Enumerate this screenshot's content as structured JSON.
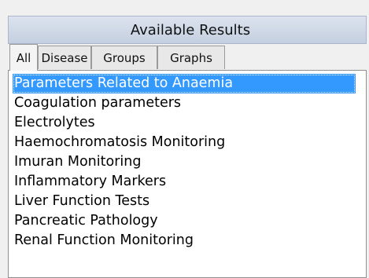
{
  "panel": {
    "title": "Available Results"
  },
  "tabs": [
    {
      "label": "All",
      "selected": true
    },
    {
      "label": "Disease",
      "selected": false
    },
    {
      "label": "Groups",
      "selected": false
    },
    {
      "label": "Graphs",
      "selected": false
    }
  ],
  "results": {
    "items": [
      {
        "label": "Parameters Related to Anaemia",
        "selected": true
      },
      {
        "label": "Coagulation parameters",
        "selected": false
      },
      {
        "label": "Electrolytes",
        "selected": false
      },
      {
        "label": "Haemochromatosis Monitoring",
        "selected": false
      },
      {
        "label": "Imuran Monitoring",
        "selected": false
      },
      {
        "label": "Inflammatory Markers",
        "selected": false
      },
      {
        "label": "Liver Function Tests",
        "selected": false
      },
      {
        "label": "Pancreatic Pathology",
        "selected": false
      },
      {
        "label": "Renal Function Monitoring",
        "selected": false
      }
    ]
  },
  "colors": {
    "selection": "#3399ff",
    "title_bar": "#c4cfe0"
  }
}
